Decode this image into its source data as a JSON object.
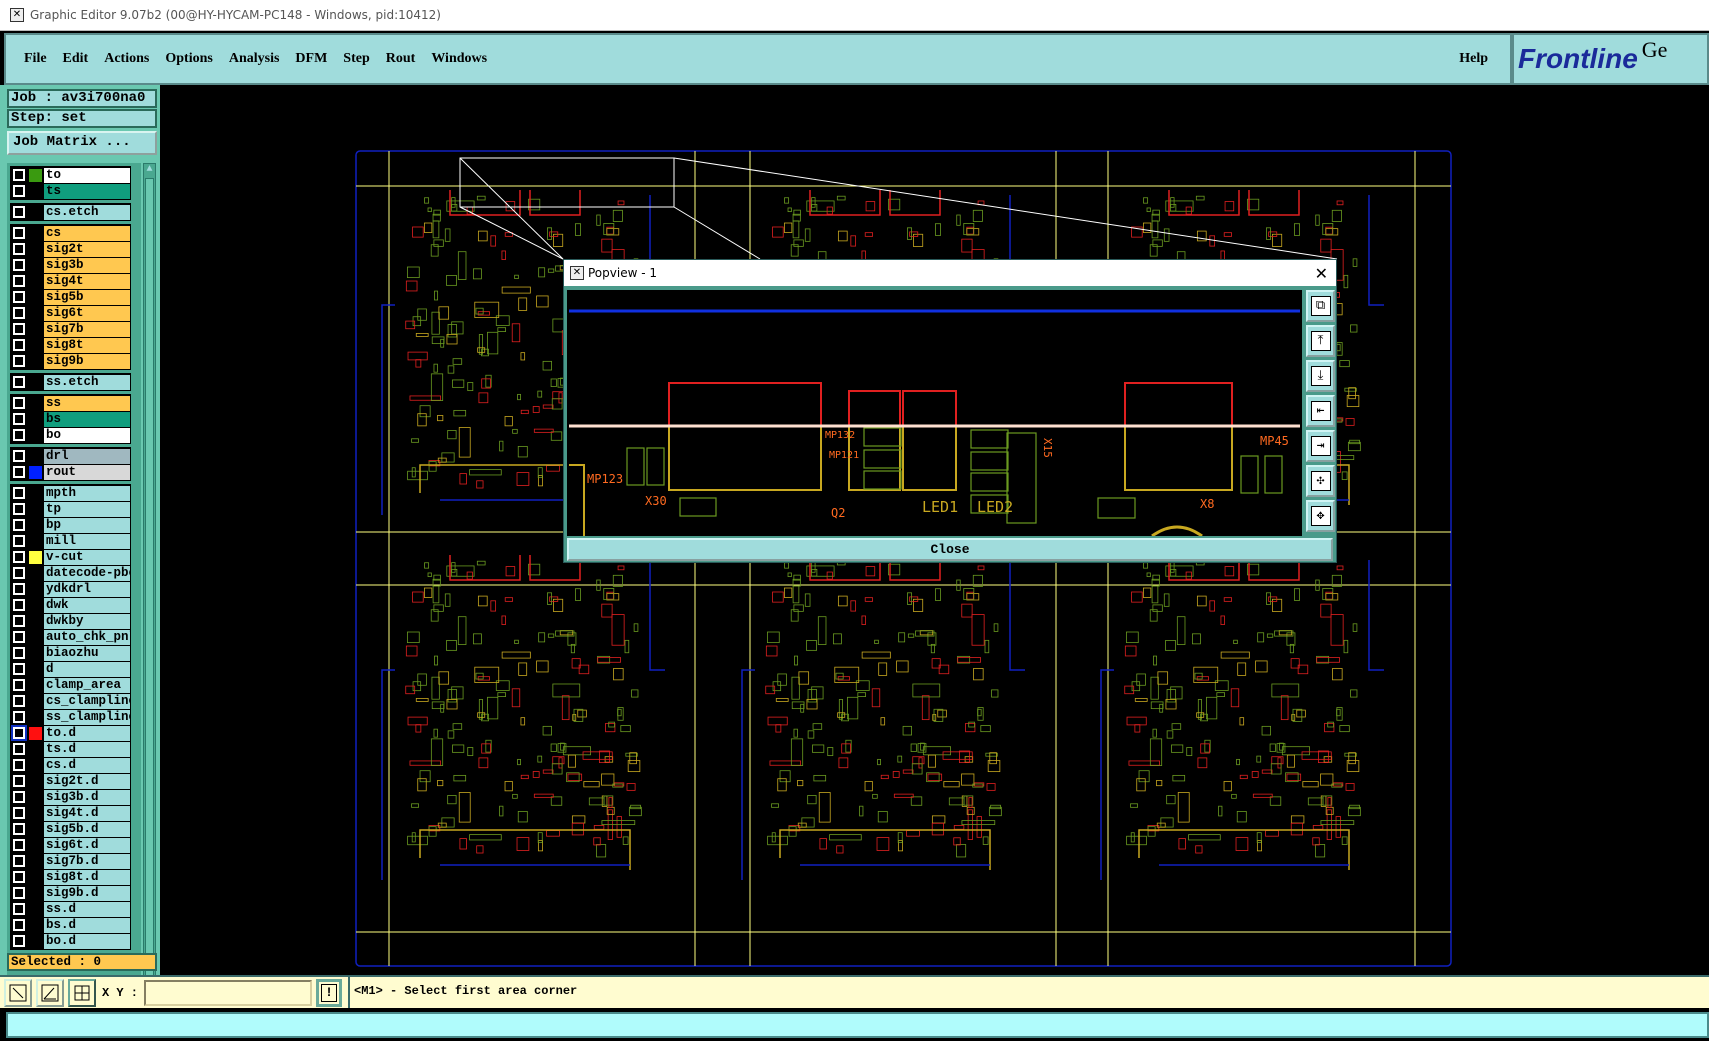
{
  "window": {
    "title": "Graphic Editor 9.07b2 (00@HY-HYCAM-PC148 - Windows, pid:10412)"
  },
  "menu": {
    "items": [
      "File",
      "Edit",
      "Actions",
      "Options",
      "Analysis",
      "DFM",
      "Step",
      "Rout",
      "Windows"
    ],
    "help": "Help"
  },
  "logo": {
    "text": "Frontline",
    "suffix": "Ge"
  },
  "job": {
    "job_label": "Job : av3i700na0",
    "step_label": "Step: set",
    "matrix_button": "Job Matrix ..."
  },
  "layers": {
    "groups": [
      [
        {
          "name": "to",
          "color": "#ffffff",
          "swatch": "#3a9a10"
        },
        {
          "name": "ts",
          "color": "#109e7e"
        }
      ],
      [
        {
          "name": "cs.etch",
          "color": "#a0dcdc"
        }
      ],
      [
        {
          "name": "cs",
          "color": "#ffc850"
        },
        {
          "name": "sig2t",
          "color": "#ffc850"
        },
        {
          "name": "sig3b",
          "color": "#ffc850"
        },
        {
          "name": "sig4t",
          "color": "#ffc850"
        },
        {
          "name": "sig5b",
          "color": "#ffc850"
        },
        {
          "name": "sig6t",
          "color": "#ffc850"
        },
        {
          "name": "sig7b",
          "color": "#ffc850"
        },
        {
          "name": "sig8t",
          "color": "#ffc850"
        },
        {
          "name": "sig9b",
          "color": "#ffc850"
        }
      ],
      [
        {
          "name": "ss.etch",
          "color": "#a0dcdc"
        }
      ],
      [
        {
          "name": "ss",
          "color": "#ffc850"
        },
        {
          "name": "bs",
          "color": "#109e7e"
        },
        {
          "name": "bo",
          "color": "#ffffff"
        }
      ],
      [
        {
          "name": "drl",
          "color": "#a0b8c0"
        },
        {
          "name": "rout",
          "color": "#d8d8d8",
          "swatch": "#0020ff"
        }
      ],
      [
        {
          "name": "mpth",
          "color": "#a0dcdc"
        },
        {
          "name": "tp",
          "color": "#a0dcdc"
        },
        {
          "name": "bp",
          "color": "#a0dcdc"
        },
        {
          "name": "mill",
          "color": "#a0dcdc"
        },
        {
          "name": "v-cut",
          "color": "#a0dcdc",
          "swatch": "#ffff40"
        },
        {
          "name": "datecode-pbc",
          "color": "#a0dcdc"
        },
        {
          "name": "ydkdrl",
          "color": "#a0dcdc"
        },
        {
          "name": "dwk",
          "color": "#a0dcdc"
        },
        {
          "name": "dwkby",
          "color": "#a0dcdc"
        },
        {
          "name": "auto_chk_pnl",
          "color": "#a0dcdc"
        },
        {
          "name": "biaozhu",
          "color": "#a0dcdc"
        },
        {
          "name": "d",
          "color": "#a0dcdc"
        },
        {
          "name": "clamp_area",
          "color": "#a0dcdc"
        },
        {
          "name": "cs_clampline",
          "color": "#a0dcdc"
        },
        {
          "name": "ss_clampline",
          "color": "#a0dcdc"
        },
        {
          "name": "to.d",
          "color": "#a0dcdc",
          "swatch": "#ff1010",
          "work": true
        },
        {
          "name": "ts.d",
          "color": "#a0dcdc"
        },
        {
          "name": "cs.d",
          "color": "#a0dcdc"
        },
        {
          "name": "sig2t.d",
          "color": "#a0dcdc"
        },
        {
          "name": "sig3b.d",
          "color": "#a0dcdc"
        },
        {
          "name": "sig4t.d",
          "color": "#a0dcdc"
        },
        {
          "name": "sig5b.d",
          "color": "#a0dcdc"
        },
        {
          "name": "sig6t.d",
          "color": "#a0dcdc"
        },
        {
          "name": "sig7b.d",
          "color": "#a0dcdc"
        },
        {
          "name": "sig8t.d",
          "color": "#a0dcdc"
        },
        {
          "name": "sig9b.d",
          "color": "#a0dcdc"
        },
        {
          "name": "ss.d",
          "color": "#a0dcdc"
        },
        {
          "name": "bs.d",
          "color": "#a0dcdc"
        },
        {
          "name": "bo.d",
          "color": "#a0dcdc"
        }
      ]
    ]
  },
  "selected": "Selected : 0",
  "status": {
    "xy_label": "X Y :",
    "xy_value": "",
    "warn": "!",
    "message": "<M1> - Select first area corner"
  },
  "popview": {
    "title": "Popview - 1",
    "close_x": "✕",
    "close_button": "Close",
    "labels": [
      "MP123",
      "MP132",
      "MP121",
      "X30",
      "Q2",
      "LED1",
      "LED2",
      "X15",
      "MP45",
      "X8"
    ],
    "tools": [
      "⧉",
      "⤒",
      "⤓",
      "⇤",
      "⇥",
      "✣",
      "✥"
    ]
  },
  "colors": {
    "accent": "#a0dcdc",
    "copper_green": "#6a9a20",
    "copper_yellow": "#c8a820",
    "pad_red": "#e02020",
    "outline_blue": "#1020c0",
    "vcut_yellow": "#ffff80"
  }
}
